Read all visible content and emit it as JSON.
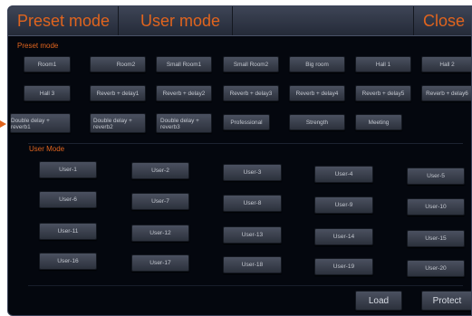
{
  "header": {
    "tabs": [
      {
        "label": "Preset mode"
      },
      {
        "label": "User mode"
      },
      {
        "label": ""
      },
      {
        "label": "Close"
      }
    ]
  },
  "preset": {
    "label": "Preset mode",
    "buttons": [
      "Room1",
      "Room2",
      "Small Room1",
      "Small Room2",
      "Big room",
      "Hall 1",
      "Hall 2",
      "Hall 3",
      "Reverb + delay1",
      "Reverb + delay2",
      "Reverb + delay3",
      "Reverb + delay4",
      "Reverb + delay5",
      "Reverb + delay6",
      "Double delay + reverb1",
      "Double delay + reverb2",
      "Double delay + reverb3",
      "Professional",
      "Strength",
      "Meeting"
    ]
  },
  "user": {
    "label": "User Mode",
    "buttons": [
      "User-1",
      "User-2",
      "User-3",
      "User-4",
      "User-5",
      "User-6",
      "User-7",
      "User-8",
      "User-9",
      "User-10",
      "User-11",
      "User-12",
      "User-13",
      "User-14",
      "User-15",
      "User-16",
      "User-17",
      "User-18",
      "User-19",
      "User-20"
    ]
  },
  "actions": {
    "load": "Load",
    "protect": "Protect"
  },
  "colors": {
    "accent": "#e0641e",
    "panel_bg": "#04070e",
    "button_bg": "#3a3f4b"
  }
}
